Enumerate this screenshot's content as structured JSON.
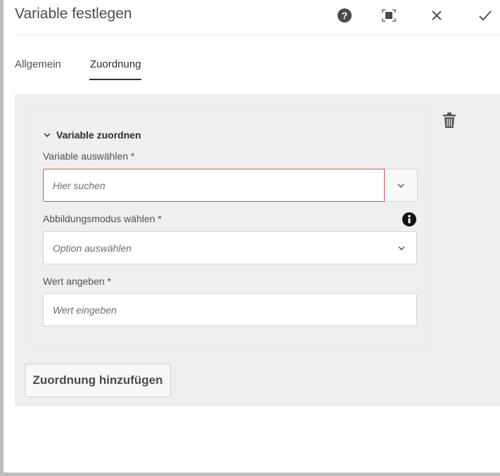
{
  "dialog": {
    "title": "Variable festlegen",
    "icons": [
      "help-icon",
      "fullscreen-icon",
      "close-icon",
      "check-icon"
    ]
  },
  "tabs": [
    {
      "label": "Allgemein"
    },
    {
      "label": "Zuordnung",
      "active": true
    }
  ],
  "mapping": {
    "section_title": "Variable zuordnen",
    "variable": {
      "label": "Variable auswählen *",
      "placeholder": "Hier suchen"
    },
    "mode": {
      "label": "Abbildungsmodus wählen *",
      "placeholder": "Option auswählen"
    },
    "value": {
      "label": "Wert angeben *",
      "placeholder": "Wert eingeben"
    }
  },
  "add_button": "Zuordnung hinzufügen",
  "colors": {
    "error": "#e34850"
  }
}
